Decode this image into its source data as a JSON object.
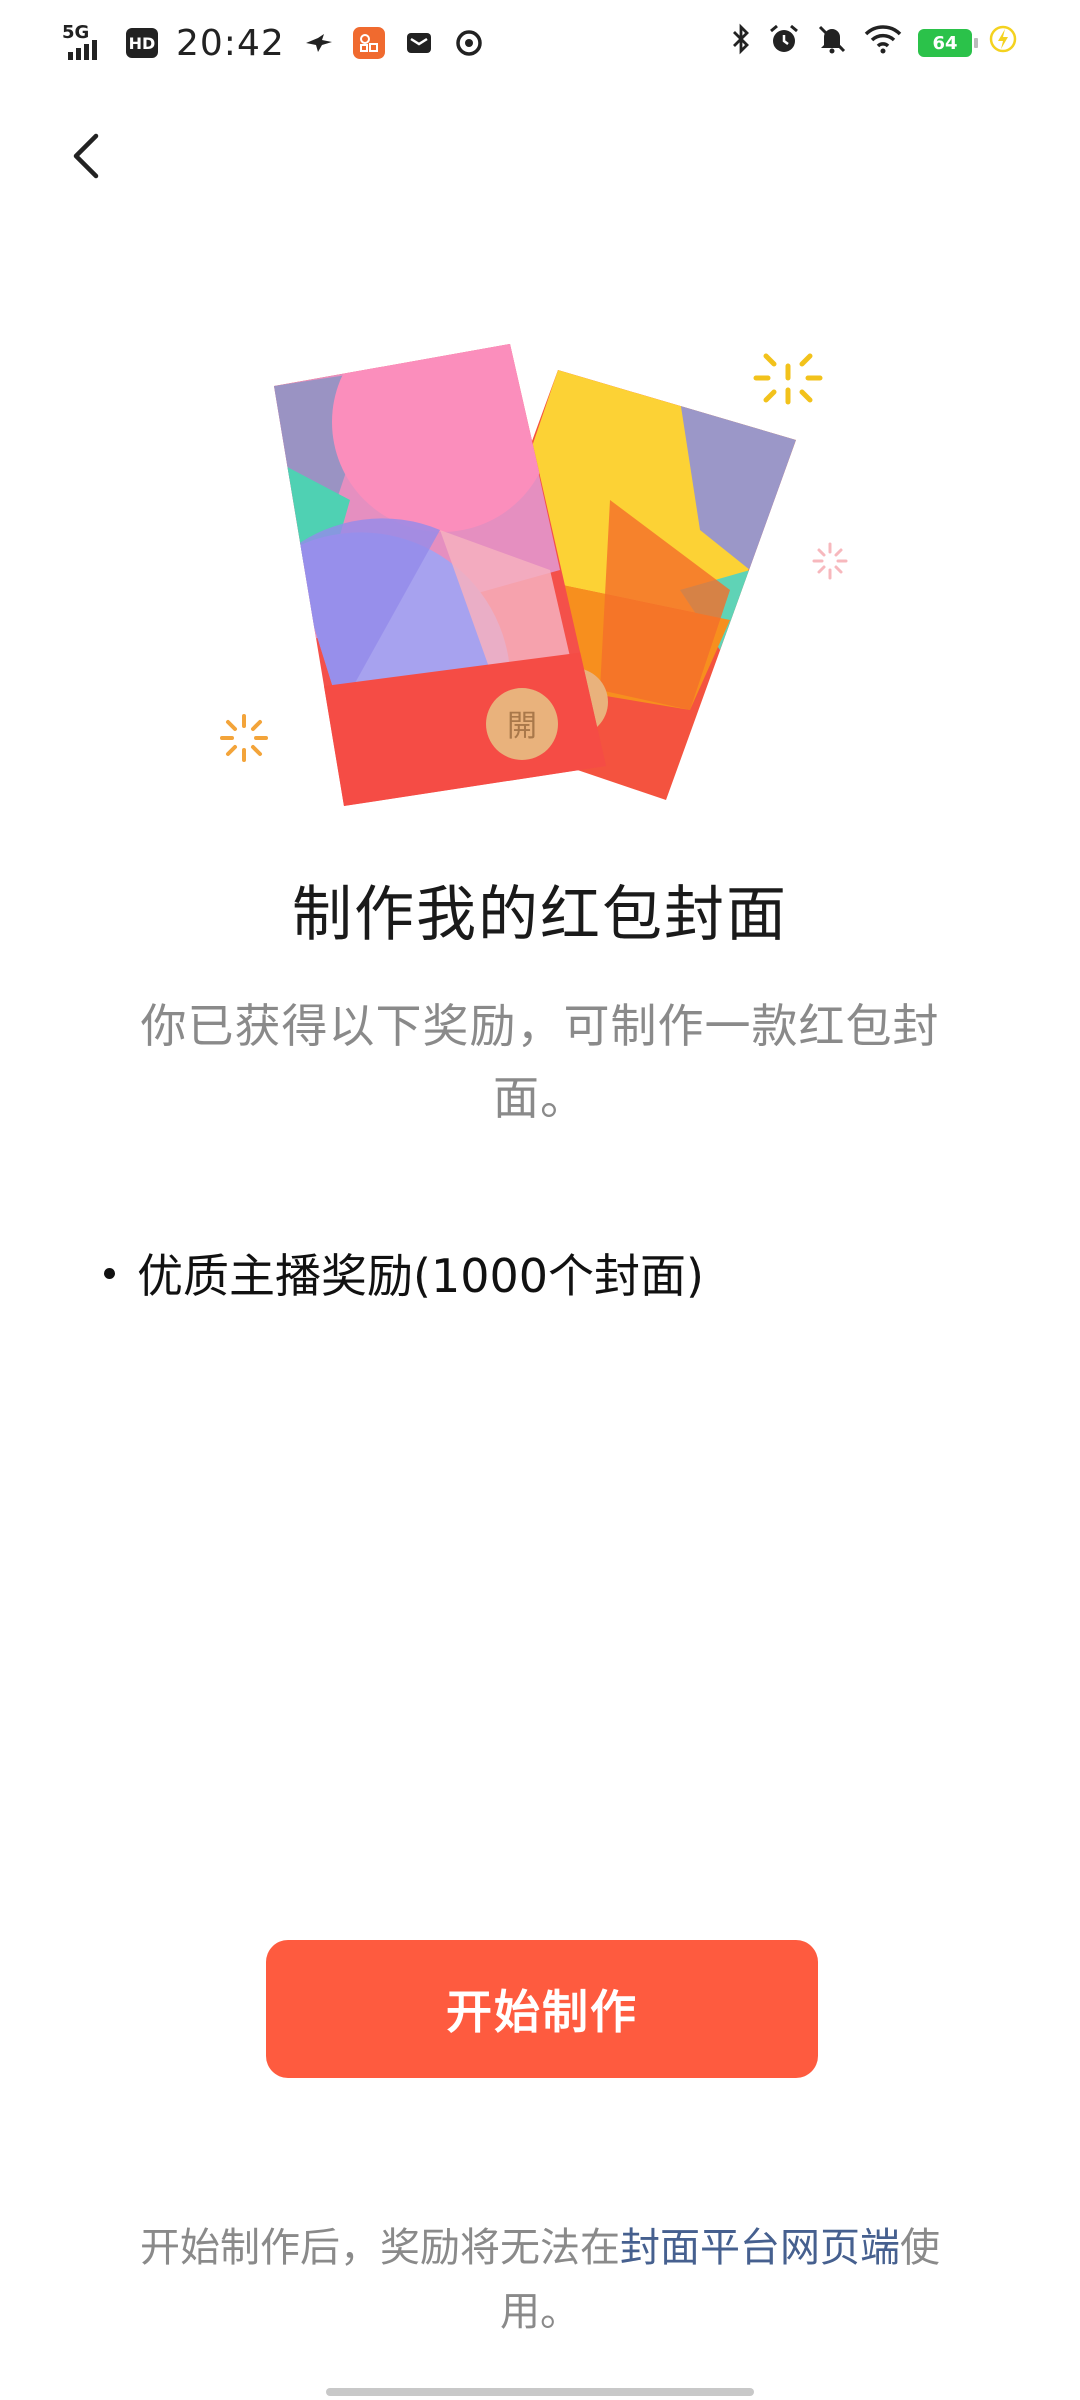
{
  "status_bar": {
    "network": "5G",
    "hd": "HD",
    "time": "20:42",
    "battery": "64"
  },
  "illustration": {
    "coin_char": "開"
  },
  "main": {
    "title": "制作我的红包封面",
    "description": "你已获得以下奖励，可制作一款红包封面。",
    "rewards": [
      {
        "label": "优质主播奖励(1000个封面)"
      }
    ]
  },
  "start_button": {
    "label": "开始制作"
  },
  "footer": {
    "text_before": "开始制作后，奖励将无法在",
    "link_text": "封面平台网页端",
    "text_after": "使用。"
  },
  "colors": {
    "accent": "#fe5b3f",
    "link": "#46608f",
    "muted_text": "#8a8a8a"
  }
}
